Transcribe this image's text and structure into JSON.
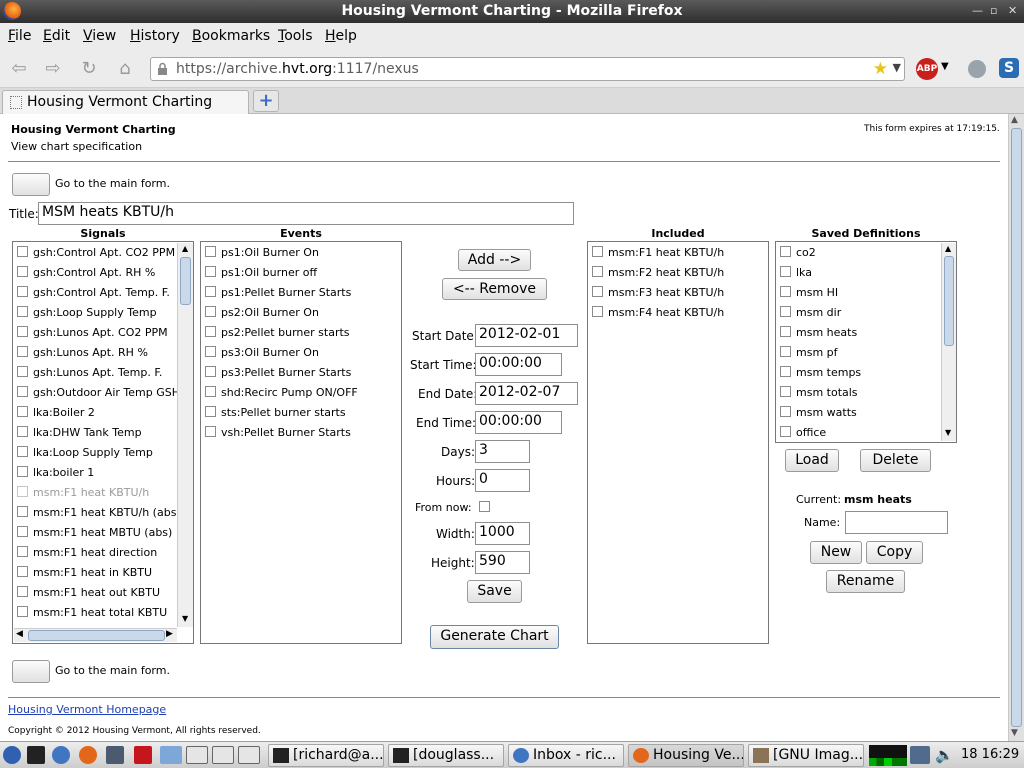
{
  "window": {
    "title": "Housing Vermont Charting - Mozilla Firefox"
  },
  "menu": [
    "File",
    "Edit",
    "View",
    "History",
    "Bookmarks",
    "Tools",
    "Help"
  ],
  "nav": {
    "url_prefix": "https://archive.",
    "url_host": "hvt.org",
    "url_suffix": ":1117/nexus"
  },
  "tab": {
    "label": "Housing Vermont Charting",
    "new_tab": "+"
  },
  "page": {
    "heading": "Housing Vermont Charting",
    "subheading": "View chart specification",
    "expires": "This form expires at 17:19:15.",
    "main_form_link": "Go to the main form.",
    "title_label": "Title:",
    "title_value": "MSM heats KBTU/h",
    "signals_header": "Signals",
    "events_header": "Events",
    "included_header": "Included",
    "saved_header": "Saved Definitions",
    "signals": [
      "gsh:Control Apt. CO2 PPM",
      "gsh:Control Apt. RH %",
      "gsh:Control Apt. Temp. F.",
      "gsh:Loop Supply Temp",
      "gsh:Lunos Apt. CO2 PPM",
      "gsh:Lunos Apt. RH %",
      "gsh:Lunos Apt. Temp. F.",
      "gsh:Outdoor Air Temp GSH",
      "lka:Boiler 2",
      "lka:DHW Tank Temp",
      "lka:Loop Supply Temp",
      "lka:boiler 1",
      "msm:F1 heat KBTU/h",
      "msm:F1 heat KBTU/h (abs)",
      "msm:F1 heat MBTU (abs)",
      "msm:F1 heat direction",
      "msm:F1 heat in KBTU",
      "msm:F1 heat out KBTU",
      "msm:F1 heat total KBTU"
    ],
    "events": [
      "ps1:Oil Burner On",
      "ps1:Oil burner off",
      "ps1:Pellet Burner Starts",
      "ps2:Oil Burner On",
      "ps2:Pellet burner starts",
      "ps3:Oil Burner On",
      "ps3:Pellet Burner Starts",
      "shd:Recirc Pump ON/OFF",
      "sts:Pellet burner starts",
      "vsh:Pellet Burner Starts"
    ],
    "included": [
      "msm:F1 heat KBTU/h",
      "msm:F2 heat KBTU/h",
      "msm:F3 heat KBTU/h",
      "msm:F4 heat KBTU/h"
    ],
    "saved": [
      "co2",
      "lka",
      "msm HI",
      "msm dir",
      "msm heats",
      "msm pf",
      "msm temps",
      "msm totals",
      "msm watts",
      "office"
    ],
    "add_button": "Add -->",
    "remove_button": "<-- Remove",
    "start_date_label": "Start Date:",
    "start_date": "2012-02-01",
    "start_time_label": "Start Time:",
    "start_time": "00:00:00",
    "end_date_label": "End Date:",
    "end_date": "2012-02-07",
    "end_time_label": "End Time:",
    "end_time": "00:00:00",
    "days_label": "Days:",
    "days": "3",
    "hours_label": "Hours:",
    "hours": "0",
    "from_now_label": "From now:",
    "width_label": "Width:",
    "width": "1000",
    "height_label": "Height:",
    "height": "590",
    "save_button": "Save",
    "generate_button": "Generate Chart",
    "load_button": "Load",
    "delete_button": "Delete",
    "current_label": "Current:",
    "current_value": "msm heats",
    "name_label": "Name:",
    "new_button": "New",
    "copy_button": "Copy",
    "rename_button": "Rename",
    "homepage_link": "Housing Vermont Homepage",
    "copyright": "Copyright © 2012 Housing Vermont, All rights reserved."
  },
  "taskbar": {
    "tasks": [
      "[richard@a...",
      "[douglass...",
      "Inbox - ric...",
      "Housing Ve...",
      "[GNU Imag..."
    ],
    "clock": "18 16:29"
  }
}
